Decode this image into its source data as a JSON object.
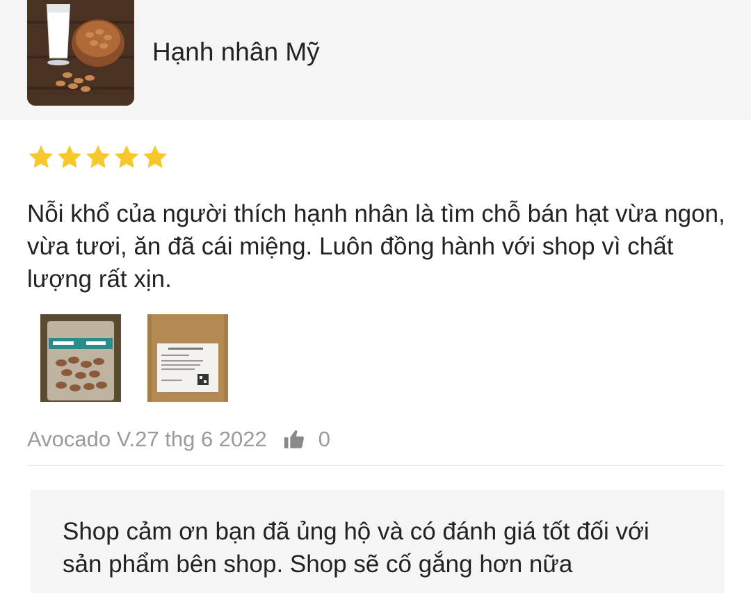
{
  "product": {
    "title": "Hạnh nhân Mỹ",
    "thumbnail_icon": "almond-milk-photo"
  },
  "review": {
    "rating": 5,
    "rating_max": 5,
    "star_color": "#f7c72c",
    "text": "Nỗi khổ của người thích hạnh nhân là tìm chỗ bán hạt vừa ngon, vừa tươi, ăn đã cái miệng. Luôn đồng hành với shop vì chất lượng rất xịn.",
    "photos": [
      "almond-bag-photo",
      "packaging-label-photo"
    ],
    "author_date": "Avocado V.27 thg 6 2022",
    "like_icon": "thumbs-up-icon",
    "like_count": "0"
  },
  "reply": {
    "text": "Shop cảm ơn bạn đã ủng hộ và có đánh giá tốt đối với sản phẩm bên shop. Shop sẽ cố gắng hơn nữa"
  }
}
